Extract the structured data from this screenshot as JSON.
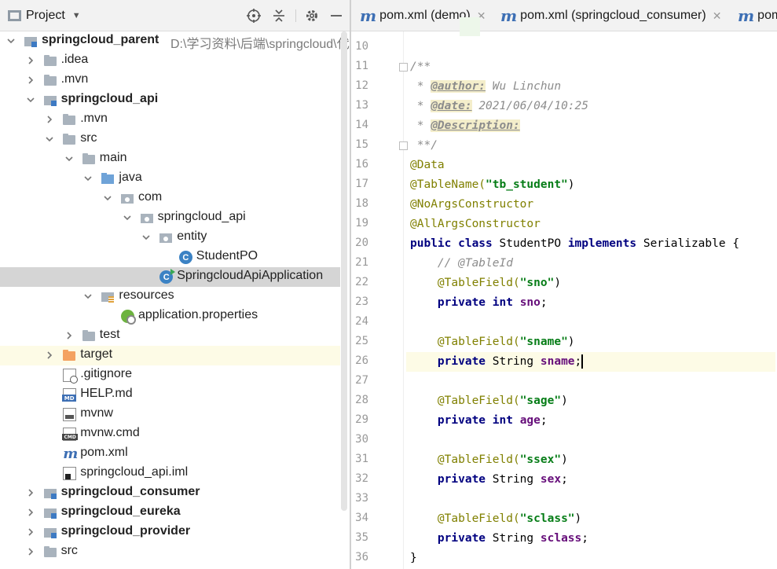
{
  "project_panel": {
    "title": "Project",
    "tree": [
      {
        "label": "springcloud_parent",
        "path": "D:\\学习资料\\后端\\springcloud\\代码",
        "depth": 0,
        "arrow": "open",
        "icon": "module-icon",
        "bold": true
      },
      {
        "label": ".idea",
        "depth": 1,
        "arrow": "closed",
        "icon": "folder-icon"
      },
      {
        "label": ".mvn",
        "depth": 1,
        "arrow": "closed",
        "icon": "folder-icon"
      },
      {
        "label": "springcloud_api",
        "depth": 1,
        "arrow": "open",
        "icon": "module-icon",
        "bold": true
      },
      {
        "label": ".mvn",
        "depth": 2,
        "arrow": "closed",
        "icon": "folder-icon"
      },
      {
        "label": "src",
        "depth": 2,
        "arrow": "open",
        "icon": "folder-icon"
      },
      {
        "label": "main",
        "depth": 3,
        "arrow": "open",
        "icon": "folder-icon"
      },
      {
        "label": "java",
        "depth": 4,
        "arrow": "open",
        "icon": "source-folder-icon"
      },
      {
        "label": "com",
        "depth": 5,
        "arrow": "open",
        "icon": "package-icon"
      },
      {
        "label": "springcloud_api",
        "depth": 6,
        "arrow": "open",
        "icon": "package-icon"
      },
      {
        "label": "entity",
        "depth": 7,
        "arrow": "open",
        "icon": "package-icon"
      },
      {
        "label": "StudentPO",
        "depth": 8,
        "arrow": "none",
        "icon": "class-icon"
      },
      {
        "label": "SpringcloudApiApplication",
        "depth": 7,
        "arrow": "none",
        "icon": "spring-app-icon",
        "selected": true
      },
      {
        "label": "resources",
        "depth": 4,
        "arrow": "open",
        "icon": "resources-folder-icon"
      },
      {
        "label": "application.properties",
        "depth": 5,
        "arrow": "none",
        "icon": "spring-properties-icon"
      },
      {
        "label": "test",
        "depth": 3,
        "arrow": "closed",
        "icon": "folder-icon"
      },
      {
        "label": "target",
        "depth": 2,
        "arrow": "closed",
        "icon": "excluded-folder-icon",
        "highlight": true
      },
      {
        "label": ".gitignore",
        "depth": 2,
        "arrow": "none",
        "icon": "ignored-file-icon"
      },
      {
        "label": "HELP.md",
        "depth": 2,
        "arrow": "none",
        "icon": "markdown-file-icon"
      },
      {
        "label": "mvnw",
        "depth": 2,
        "arrow": "none",
        "icon": "executable-file-icon"
      },
      {
        "label": "mvnw.cmd",
        "depth": 2,
        "arrow": "none",
        "icon": "cmd-file-icon"
      },
      {
        "label": "pom.xml",
        "depth": 2,
        "arrow": "none",
        "icon": "maven-icon"
      },
      {
        "label": "springcloud_api.iml",
        "depth": 2,
        "arrow": "none",
        "icon": "iml-file-icon"
      },
      {
        "label": "springcloud_consumer",
        "depth": 1,
        "arrow": "closed",
        "icon": "module-icon",
        "bold": true
      },
      {
        "label": "springcloud_eureka",
        "depth": 1,
        "arrow": "closed",
        "icon": "module-icon",
        "bold": true
      },
      {
        "label": "springcloud_provider",
        "depth": 1,
        "arrow": "closed",
        "icon": "module-icon",
        "bold": true
      },
      {
        "label": "src",
        "depth": 1,
        "arrow": "closed",
        "icon": "folder-icon"
      }
    ]
  },
  "tabs": [
    {
      "label": "pom.xml (demo)",
      "icon": "maven-icon"
    },
    {
      "label": "pom.xml (springcloud_consumer)",
      "icon": "maven-icon"
    },
    {
      "label": "pom.xml",
      "icon": "maven-icon"
    }
  ],
  "editor": {
    "current_line": 26,
    "lines": [
      {
        "n": 10,
        "tokens": []
      },
      {
        "n": 11,
        "fold": true,
        "tokens": [
          {
            "t": "/**",
            "c": "doc"
          }
        ]
      },
      {
        "n": 12,
        "tokens": [
          {
            "t": " * ",
            "c": "doc"
          },
          {
            "t": "@author:",
            "c": "doctag"
          },
          {
            "t": " Wu Linchun",
            "c": "docval"
          }
        ]
      },
      {
        "n": 13,
        "tokens": [
          {
            "t": " * ",
            "c": "doc"
          },
          {
            "t": "@date:",
            "c": "doctag"
          },
          {
            "t": " 2021/06/04/10:25",
            "c": "docval"
          }
        ]
      },
      {
        "n": 14,
        "tokens": [
          {
            "t": " * ",
            "c": "doc"
          },
          {
            "t": "@Description:",
            "c": "doctag"
          }
        ]
      },
      {
        "n": 15,
        "fold": true,
        "tokens": [
          {
            "t": " **/",
            "c": "doc"
          }
        ]
      },
      {
        "n": 16,
        "tokens": [
          {
            "t": "@Data",
            "c": "ann"
          }
        ]
      },
      {
        "n": 17,
        "tokens": [
          {
            "t": "@TableName(",
            "c": "ann"
          },
          {
            "t": "\"tb_student\"",
            "c": "str"
          },
          {
            "t": ")",
            "c": "plain"
          }
        ]
      },
      {
        "n": 18,
        "tokens": [
          {
            "t": "@NoArgsConstructor",
            "c": "ann"
          }
        ]
      },
      {
        "n": 19,
        "tokens": [
          {
            "t": "@AllArgsConstructor",
            "c": "ann"
          }
        ]
      },
      {
        "n": 20,
        "tokens": [
          {
            "t": "public class ",
            "c": "kw"
          },
          {
            "t": "StudentPO ",
            "c": "plain"
          },
          {
            "t": "implements ",
            "c": "kw"
          },
          {
            "t": "Serializable {",
            "c": "plain"
          }
        ]
      },
      {
        "n": 21,
        "tokens": [
          {
            "t": "    // @TableId",
            "c": "comment"
          }
        ]
      },
      {
        "n": 22,
        "tokens": [
          {
            "t": "    ",
            "c": "plain"
          },
          {
            "t": "@TableField(",
            "c": "ann"
          },
          {
            "t": "\"sno\"",
            "c": "str"
          },
          {
            "t": ")",
            "c": "plain"
          }
        ]
      },
      {
        "n": 23,
        "tokens": [
          {
            "t": "    ",
            "c": "plain"
          },
          {
            "t": "private int ",
            "c": "kw"
          },
          {
            "t": "sno",
            "c": "field"
          },
          {
            "t": ";",
            "c": "plain"
          }
        ]
      },
      {
        "n": 24,
        "tokens": []
      },
      {
        "n": 25,
        "tokens": [
          {
            "t": "    ",
            "c": "plain"
          },
          {
            "t": "@TableField(",
            "c": "ann"
          },
          {
            "t": "\"sname\"",
            "c": "str"
          },
          {
            "t": ")",
            "c": "plain"
          }
        ]
      },
      {
        "n": 26,
        "tokens": [
          {
            "t": "    ",
            "c": "plain"
          },
          {
            "t": "private ",
            "c": "kw"
          },
          {
            "t": "String ",
            "c": "plain"
          },
          {
            "t": "sname",
            "c": "field"
          },
          {
            "t": ";",
            "c": "plain"
          }
        ],
        "caret": true
      },
      {
        "n": 27,
        "tokens": []
      },
      {
        "n": 28,
        "tokens": [
          {
            "t": "    ",
            "c": "plain"
          },
          {
            "t": "@TableField(",
            "c": "ann"
          },
          {
            "t": "\"sage\"",
            "c": "str"
          },
          {
            "t": ")",
            "c": "plain"
          }
        ]
      },
      {
        "n": 29,
        "tokens": [
          {
            "t": "    ",
            "c": "plain"
          },
          {
            "t": "private int ",
            "c": "kw"
          },
          {
            "t": "age",
            "c": "field"
          },
          {
            "t": ";",
            "c": "plain"
          }
        ]
      },
      {
        "n": 30,
        "tokens": []
      },
      {
        "n": 31,
        "tokens": [
          {
            "t": "    ",
            "c": "plain"
          },
          {
            "t": "@TableField(",
            "c": "ann"
          },
          {
            "t": "\"ssex\"",
            "c": "str"
          },
          {
            "t": ")",
            "c": "plain"
          }
        ]
      },
      {
        "n": 32,
        "tokens": [
          {
            "t": "    ",
            "c": "plain"
          },
          {
            "t": "private ",
            "c": "kw"
          },
          {
            "t": "String ",
            "c": "plain"
          },
          {
            "t": "sex",
            "c": "field"
          },
          {
            "t": ";",
            "c": "plain"
          }
        ]
      },
      {
        "n": 33,
        "tokens": []
      },
      {
        "n": 34,
        "tokens": [
          {
            "t": "    ",
            "c": "plain"
          },
          {
            "t": "@TableField(",
            "c": "ann"
          },
          {
            "t": "\"sclass\"",
            "c": "str"
          },
          {
            "t": ")",
            "c": "plain"
          }
        ]
      },
      {
        "n": 35,
        "tokens": [
          {
            "t": "    ",
            "c": "plain"
          },
          {
            "t": "private ",
            "c": "kw"
          },
          {
            "t": "String ",
            "c": "plain"
          },
          {
            "t": "sclass",
            "c": "field"
          },
          {
            "t": ";",
            "c": "plain"
          }
        ]
      },
      {
        "n": 36,
        "tokens": [
          {
            "t": "}",
            "c": "plain"
          }
        ]
      }
    ]
  },
  "colors": {
    "keyword": "#000080",
    "annotation": "#808000",
    "string": "#067d17",
    "field": "#660e7a",
    "comment": "#8c8c8c",
    "selection": "#d5d5d5",
    "current_line": "#fdfbe6"
  }
}
